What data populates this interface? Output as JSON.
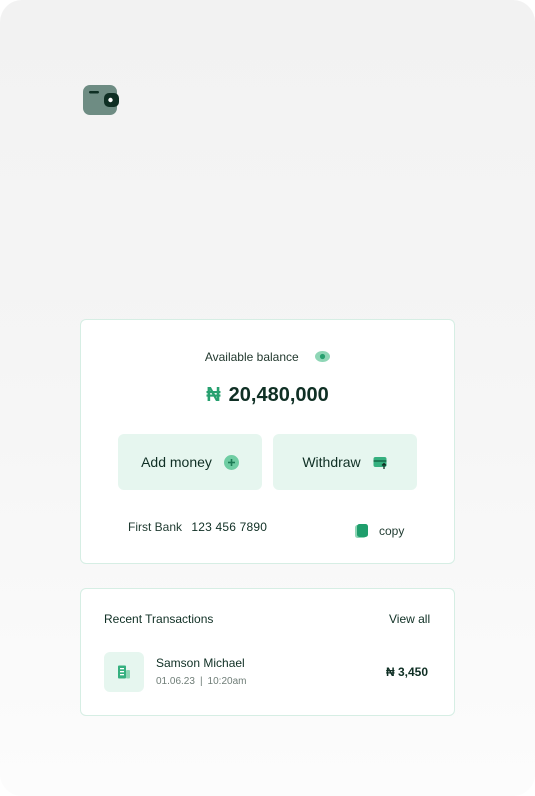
{
  "wallet_icon": "wallet-icon",
  "balance": {
    "label": "Available balance",
    "currency_symbol": "₦",
    "amount": "20,480,000",
    "visibility_icon": "eye-icon"
  },
  "actions": {
    "add_money_label": "Add money",
    "add_money_icon": "plus-circle-icon",
    "withdraw_label": "Withdraw",
    "withdraw_icon": "card-withdraw-icon"
  },
  "bank": {
    "name": "First Bank",
    "account_number": "123 456 7890",
    "copy_label": "copy",
    "copy_icon": "copy-icon"
  },
  "transactions": {
    "title": "Recent Transactions",
    "view_all_label": "View all",
    "items": [
      {
        "name": "Samson Michael",
        "date": "01.06.23",
        "separator": "|",
        "time": "10:20am",
        "amount": "₦ 3,450",
        "icon": "building-icon"
      }
    ]
  },
  "colors": {
    "accent": "#27a06f",
    "button_bg": "#e6f6ef",
    "card_border": "#d6eee4",
    "text_dark": "#0f2f24"
  }
}
